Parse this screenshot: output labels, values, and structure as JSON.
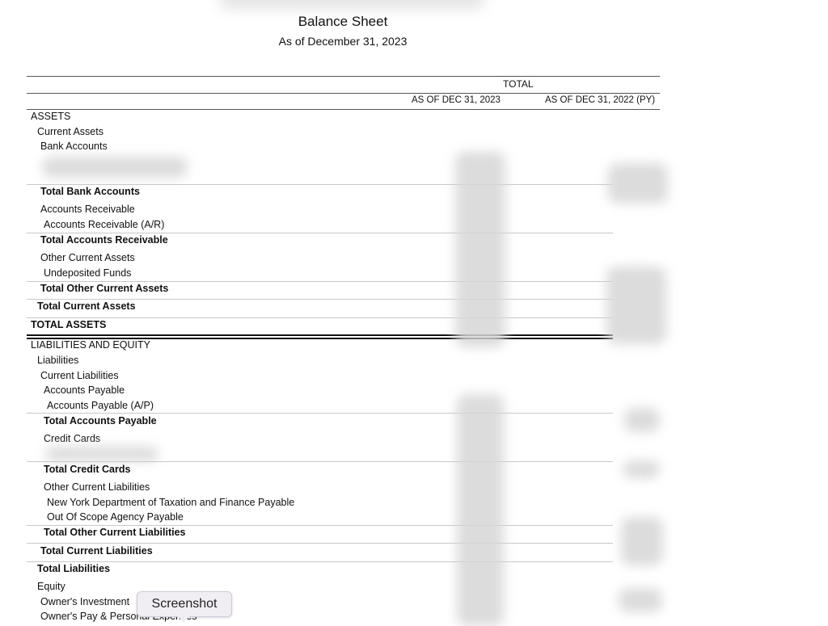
{
  "report": {
    "title": "Balance Sheet",
    "subtitle": "As of December 31, 2023"
  },
  "columns": {
    "group_label": "TOTAL",
    "current": "AS OF DEC 31, 2023",
    "prior": "AS OF DEC 31, 2022 (PY)"
  },
  "rows": [
    {
      "label": "ASSETS",
      "bold": false
    },
    {
      "label": "Current Assets",
      "bold": false
    },
    {
      "label": "Bank Accounts",
      "bold": false
    },
    {
      "label": "Total Bank Accounts",
      "bold": true
    },
    {
      "label": "Accounts Receivable",
      "bold": false
    },
    {
      "label": "Accounts Receivable (A/R)",
      "bold": false
    },
    {
      "label": "Total Accounts Receivable",
      "bold": true
    },
    {
      "label": "Other Current Assets",
      "bold": false
    },
    {
      "label": "Undeposited Funds",
      "bold": false
    },
    {
      "label": "Total Other Current Assets",
      "bold": true
    },
    {
      "label": "Total Current Assets",
      "bold": true
    },
    {
      "label": "TOTAL ASSETS",
      "bold": true
    },
    {
      "label": "LIABILITIES AND EQUITY",
      "bold": false
    },
    {
      "label": "Liabilities",
      "bold": false
    },
    {
      "label": "Current Liabilities",
      "bold": false
    },
    {
      "label": "Accounts Payable",
      "bold": false
    },
    {
      "label": "Accounts Payable (A/P)",
      "bold": false
    },
    {
      "label": "Total Accounts Payable",
      "bold": true
    },
    {
      "label": "Credit Cards",
      "bold": false
    },
    {
      "label": "Total Credit Cards",
      "bold": true
    },
    {
      "label": "Other Current Liabilities",
      "bold": false
    },
    {
      "label": "New York Department of Taxation and Finance Payable",
      "bold": false
    },
    {
      "label": "Out Of Scope Agency Payable",
      "bold": false
    },
    {
      "label": "Total Other Current Liabilities",
      "bold": true
    },
    {
      "label": "Total Current Liabilities",
      "bold": true
    },
    {
      "label": "Total Liabilities",
      "bold": true
    },
    {
      "label": "Equity",
      "bold": false
    },
    {
      "label": "Owner's Investment",
      "bold": false
    },
    {
      "label": "Owner's Pay & Personal Expenses",
      "bold": false
    }
  ],
  "tooltip": {
    "label": "Screenshot"
  }
}
